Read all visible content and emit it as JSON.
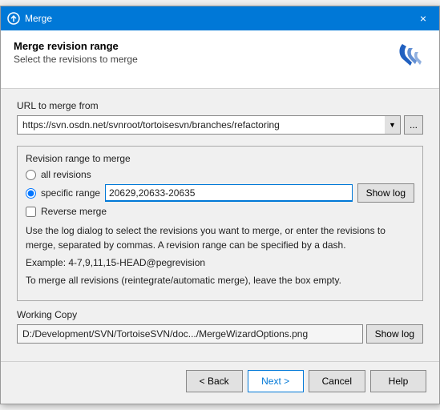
{
  "window": {
    "title": "Merge",
    "close_label": "×"
  },
  "header": {
    "title": "Merge revision range",
    "subtitle": "Select the revisions to merge"
  },
  "url_section": {
    "label": "URL to merge from",
    "value": "https://svn.osdn.net/svnroot/tortoisesvn/branches/refactoring",
    "browse_label": "..."
  },
  "revision_section": {
    "label": "Revision range to merge",
    "all_revisions_label": "all revisions",
    "specific_range_label": "specific range",
    "range_value": "20629,20633-20635",
    "show_log_label": "Show log",
    "reverse_merge_label": "Reverse merge",
    "help_text": "Use the log dialog to select the revisions you want to merge, or enter the revisions to merge, separated by commas. A revision range can be specified by a dash.",
    "example_text": "Example: 4-7,9,11,15-HEAD@pegrevision",
    "auto_merge_text": "To merge all revisions (reintegrate/automatic merge), leave the box empty."
  },
  "working_copy": {
    "label": "Working Copy",
    "value": "D:/Development/SVN/TortoiseSVN/doc.../MergeWizardOptions.png",
    "show_log_label": "Show log"
  },
  "footer": {
    "back_label": "< Back",
    "next_label": "Next >",
    "cancel_label": "Cancel",
    "help_label": "Help"
  }
}
